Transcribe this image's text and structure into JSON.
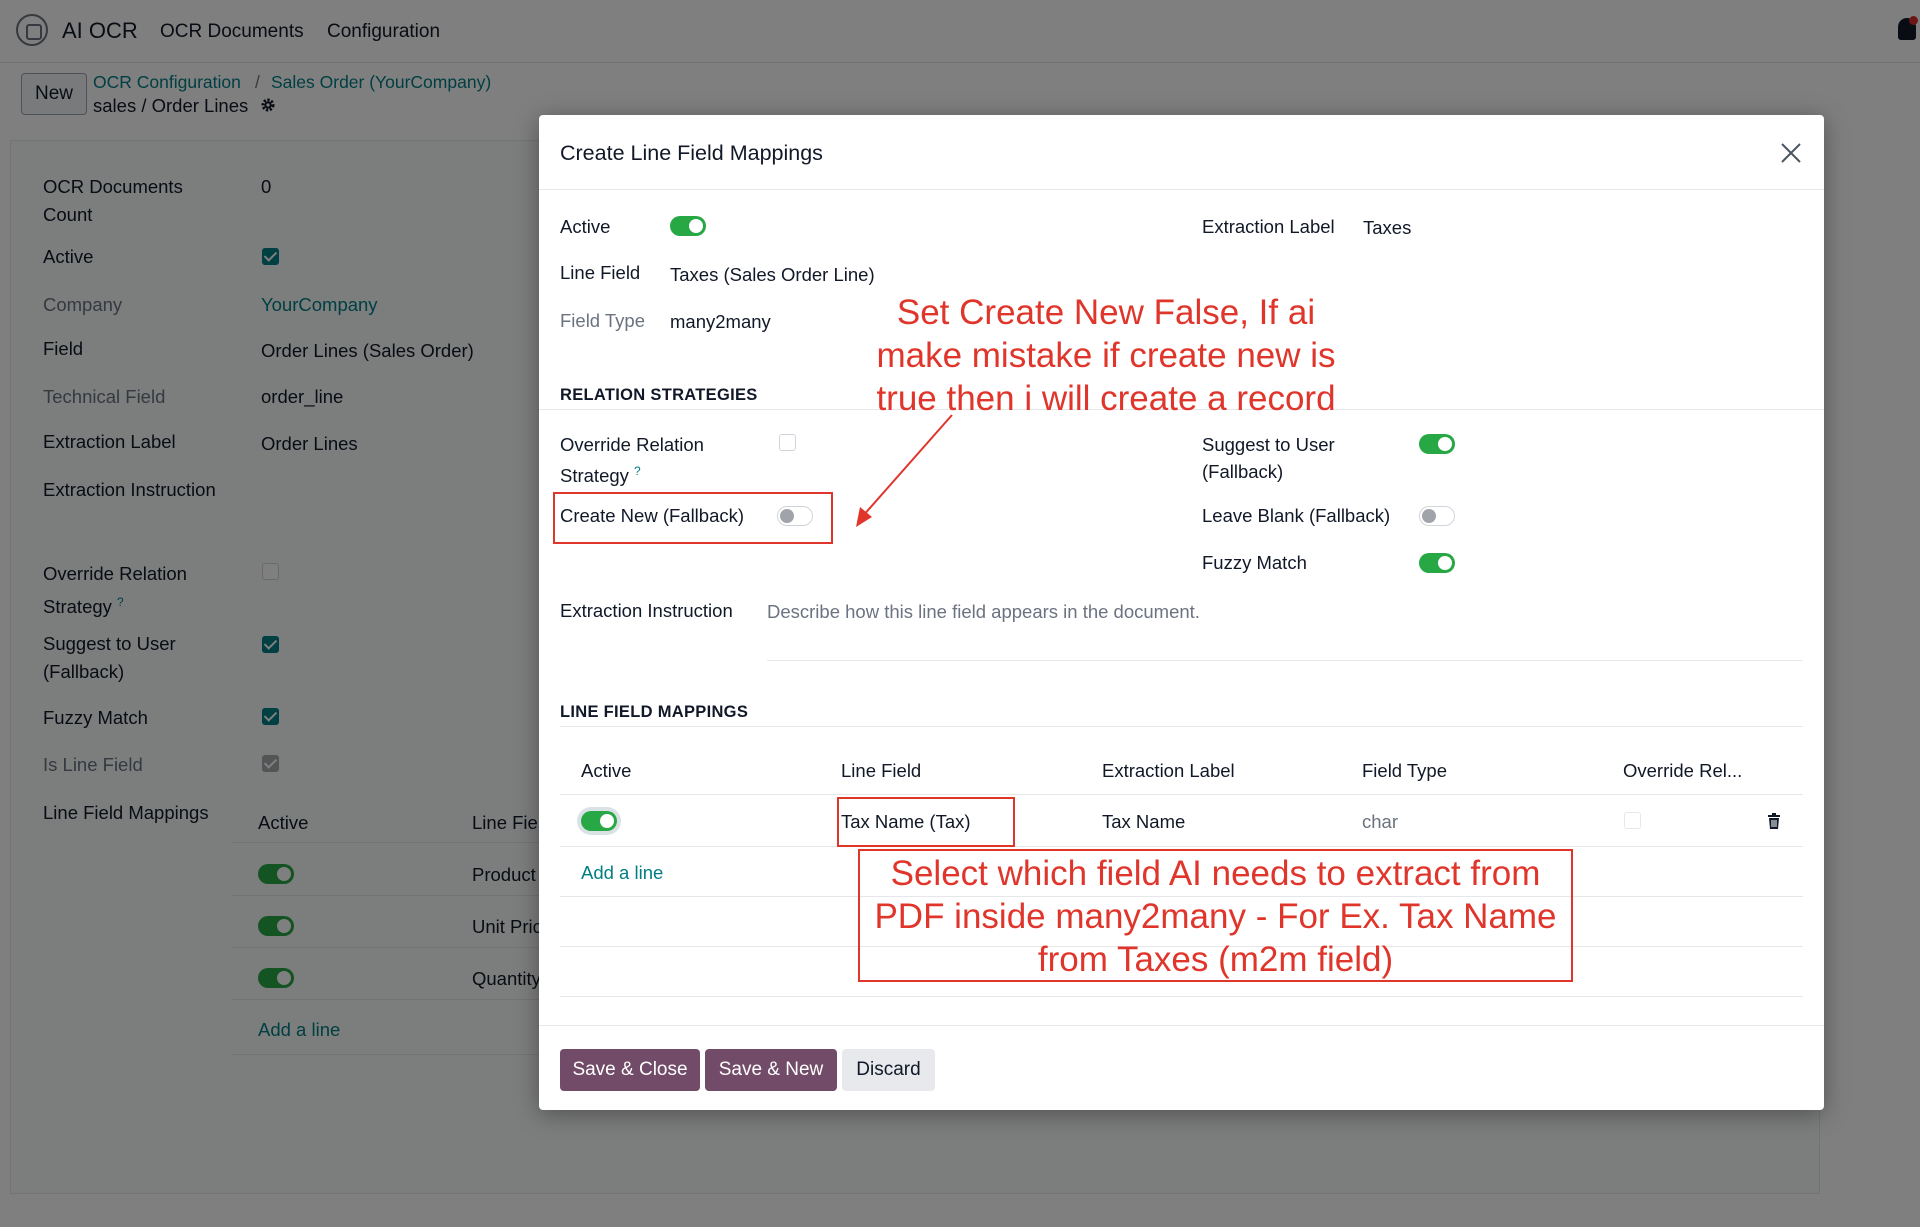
{
  "navbar": {
    "brand": "AI OCR",
    "menu": [
      "OCR Documents",
      "Configuration"
    ]
  },
  "breadcrumb": {
    "new_label": "New",
    "items": [
      "OCR Configuration",
      "Sales Order (YourCompany)"
    ],
    "separator": "/",
    "current": "sales / Order Lines"
  },
  "form": {
    "ocr_documents_count_label": "OCR Documents Count",
    "ocr_documents_count_value": "0",
    "active_label": "Active",
    "active_checked": true,
    "company_label": "Company",
    "company_value": "YourCompany",
    "field_label": "Field",
    "field_value": "Order Lines (Sales Order)",
    "technical_field_label": "Technical Field",
    "technical_field_value": "order_line",
    "extraction_label_label": "Extraction Label",
    "extraction_label_value": "Order Lines",
    "extraction_instruction_label": "Extraction Instruction",
    "override_relation_label": "Override Relation Strategy",
    "override_relation_help": "?",
    "override_relation_checked": false,
    "suggest_label": "Suggest to User (Fallback)",
    "suggest_checked": true,
    "fuzzy_label": "Fuzzy Match",
    "fuzzy_checked": true,
    "is_line_label": "Is Line Field",
    "is_line_checked": true,
    "line_mappings_label": "Line Field Mappings",
    "table_headers": [
      "Active",
      "Line Fie"
    ],
    "rows": [
      {
        "active": true,
        "line_field": "Product"
      },
      {
        "active": true,
        "line_field": "Unit Pric"
      },
      {
        "active": true,
        "line_field": "Quantity"
      }
    ],
    "add_line": "Add a line"
  },
  "modal": {
    "title": "Create Line Field Mappings",
    "active_label": "Active",
    "active_on": true,
    "extraction_label_label": "Extraction Label",
    "extraction_label_value": "Taxes",
    "line_field_label": "Line Field",
    "line_field_value": "Taxes (Sales Order Line)",
    "field_type_label": "Field Type",
    "field_type_value": "many2many",
    "relation_strategies_title": "RELATION STRATEGIES",
    "override_relation_label": "Override Relation Strategy",
    "override_relation_help": "?",
    "override_relation_checked": false,
    "create_new_label": "Create New (Fallback)",
    "create_new_on": false,
    "suggest_label": "Suggest to User (Fallback)",
    "suggest_on": true,
    "leave_blank_label": "Leave Blank (Fallback)",
    "leave_blank_on": false,
    "fuzzy_label": "Fuzzy Match",
    "fuzzy_on": true,
    "extraction_instruction_label": "Extraction Instruction",
    "extraction_instruction_placeholder": "Describe how this line field appears in the document.",
    "line_mappings_title": "LINE FIELD MAPPINGS",
    "table_headers": [
      "Active",
      "Line Field",
      "Extraction Label",
      "Field Type",
      "Override Rel..."
    ],
    "rows": [
      {
        "active": true,
        "line_field": "Tax Name (Tax)",
        "extraction_label": "Tax Name",
        "field_type": "char",
        "override": false
      }
    ],
    "add_line": "Add a line",
    "buttons": {
      "save_close": "Save & Close",
      "save_new": "Save & New",
      "discard": "Discard"
    }
  },
  "annotations": {
    "top": [
      "Set Create New False, If ai",
      "make mistake if create new is",
      "true then i will create a record"
    ],
    "bottom": [
      "Select which field AI needs to extract from",
      "PDF inside many2many -  For Ex. Tax Name",
      "from Taxes (m2m field)"
    ]
  },
  "colors": {
    "accent_teal": "#017e84",
    "primary_purple": "#714b67",
    "toggle_green": "#28a745",
    "annotation_red": "#e0352b"
  }
}
